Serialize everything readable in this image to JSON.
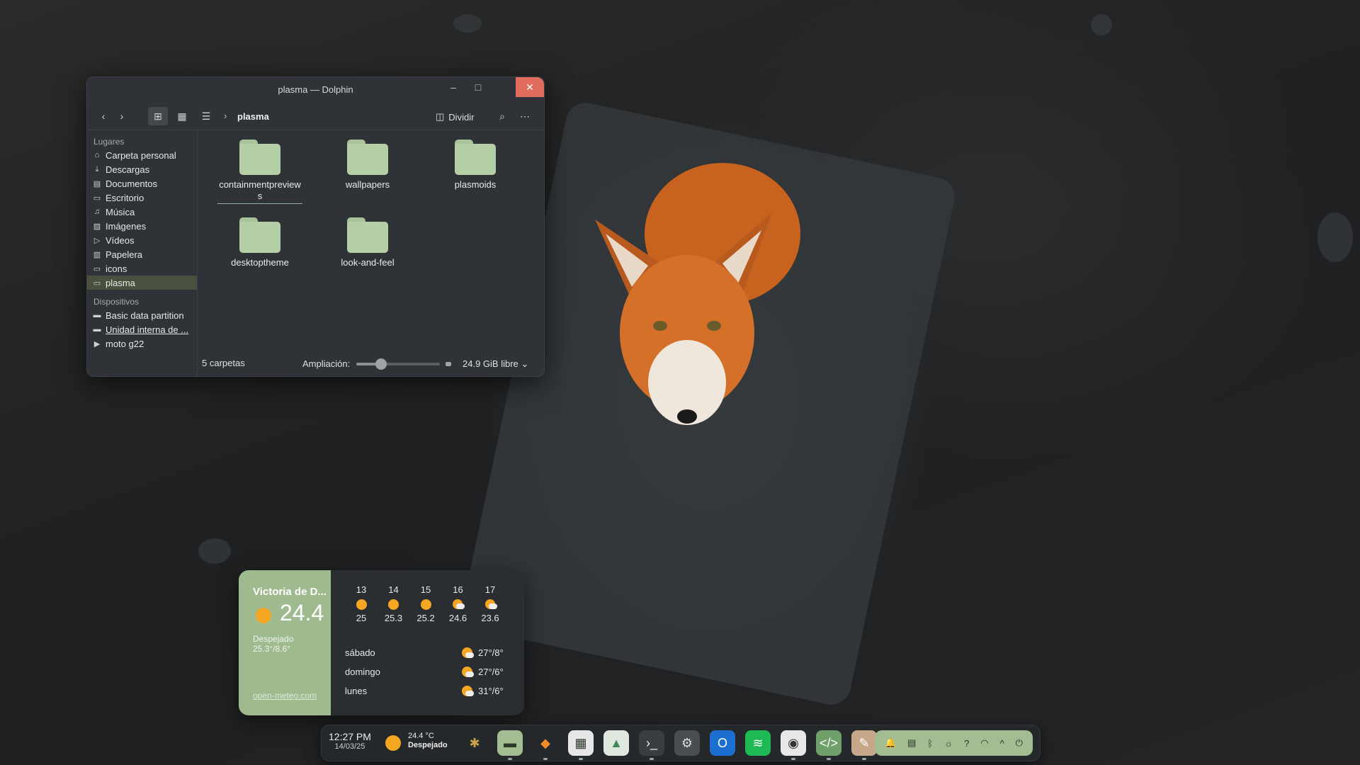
{
  "window": {
    "title": "plasma — Dolphin",
    "breadcrumb_current": "plasma",
    "split_label": "Dividir",
    "controls": {
      "minimize": "–",
      "maximize": "□",
      "close": "✕"
    }
  },
  "sidebar": {
    "places_header": "Lugares",
    "places": [
      {
        "label": "Carpeta personal",
        "icon": "home-icon",
        "glyph": "⌂"
      },
      {
        "label": "Descargas",
        "icon": "download-icon",
        "glyph": "⤓"
      },
      {
        "label": "Documentos",
        "icon": "document-icon",
        "glyph": "▤"
      },
      {
        "label": "Escritorio",
        "icon": "desktop-icon",
        "glyph": "▭"
      },
      {
        "label": "Música",
        "icon": "music-icon",
        "glyph": "♫"
      },
      {
        "label": "Imágenes",
        "icon": "image-icon",
        "glyph": "▨"
      },
      {
        "label": "Vídeos",
        "icon": "video-icon",
        "glyph": "▷"
      },
      {
        "label": "Papelera",
        "icon": "trash-icon",
        "glyph": "▥"
      },
      {
        "label": "icons",
        "icon": "folder-icon",
        "glyph": "▭"
      },
      {
        "label": "plasma",
        "icon": "folder-icon",
        "glyph": "▭"
      }
    ],
    "devices_header": "Dispositivos",
    "devices": [
      {
        "label": "Basic data partition",
        "icon": "drive-icon",
        "glyph": "▬"
      },
      {
        "label": "Unidad interna de ...",
        "icon": "drive-icon",
        "glyph": "▬"
      },
      {
        "label": "moto g22",
        "icon": "phone-icon",
        "glyph": "▶"
      }
    ]
  },
  "folders": [
    {
      "label": "containmentpreviews",
      "selected": true
    },
    {
      "label": "wallpapers"
    },
    {
      "label": "plasmoids"
    },
    {
      "label": "desktoptheme"
    },
    {
      "label": "look-and-feel"
    }
  ],
  "status": {
    "count": "5 carpetas",
    "zoom_label": "Ampliación:",
    "zoom_fraction": 0.3,
    "free_space": "24.9 GiB libre"
  },
  "weather": {
    "city": "Victoria de D...",
    "temp": "24.4",
    "condition": "Despejado",
    "range": "25.3°/8.6°",
    "source": "open-meteo.com",
    "hourly": [
      {
        "hour": "13",
        "temp": "25",
        "icon": "sun"
      },
      {
        "hour": "14",
        "temp": "25.3",
        "icon": "sun"
      },
      {
        "hour": "15",
        "temp": "25.2",
        "icon": "sun"
      },
      {
        "hour": "16",
        "temp": "24.6",
        "icon": "partly-cloudy"
      },
      {
        "hour": "17",
        "temp": "23.6",
        "icon": "partly-cloudy"
      }
    ],
    "daily": [
      {
        "day": "sábado",
        "temps": "27°/8°"
      },
      {
        "day": "domingo",
        "temps": "27°/6°"
      },
      {
        "day": "lunes",
        "temps": "31°/6°"
      }
    ]
  },
  "taskbar": {
    "time": "12:27 PM",
    "date": "14/03/25",
    "weather_temp": "24.4 °C",
    "weather_cond": "Despejado",
    "apps": [
      {
        "name": "kde-menu-icon",
        "glyph": "✱",
        "color": "#c9a24a",
        "bg": "transparent"
      },
      {
        "name": "dolphin-icon",
        "glyph": "▬",
        "color": "#2b3a2b",
        "bg": "#a3bd93",
        "running": true
      },
      {
        "name": "firefox-icon",
        "glyph": "◆",
        "color": "#f08a2a",
        "bg": "transparent",
        "running": true
      },
      {
        "name": "store-icon",
        "glyph": "▦",
        "color": "#2b3a2b",
        "bg": "#e6e6e6",
        "running": true
      },
      {
        "name": "image-viewer-icon",
        "glyph": "▲",
        "color": "#3c8a5a",
        "bg": "#dfe8df"
      },
      {
        "name": "terminal-icon",
        "glyph": "›_",
        "color": "#eee",
        "bg": "#3a3d40",
        "running": true
      },
      {
        "name": "settings-icon",
        "glyph": "⚙",
        "color": "#ddd",
        "bg": "#4a4d50"
      },
      {
        "name": "outlook-icon",
        "glyph": "O",
        "color": "#fff",
        "bg": "#1a6fd0"
      },
      {
        "name": "spotify-icon",
        "glyph": "≋",
        "color": "#fff",
        "bg": "#1db954"
      },
      {
        "name": "android-icon",
        "glyph": "◉",
        "color": "#333",
        "bg": "#e8e8e8",
        "running": true
      },
      {
        "name": "code-editor-icon",
        "glyph": "</>",
        "color": "#fff",
        "bg": "#6fa06a",
        "running": true
      },
      {
        "name": "feather-app-icon",
        "glyph": "✎",
        "color": "#fff",
        "bg": "#c7a78a",
        "running": true
      }
    ],
    "tray": [
      {
        "name": "notifications-icon",
        "glyph": "🔔"
      },
      {
        "name": "clipboard-icon",
        "glyph": "▤"
      },
      {
        "name": "bluetooth-icon",
        "glyph": "ᛒ"
      },
      {
        "name": "brightness-icon",
        "glyph": "☼"
      },
      {
        "name": "help-icon",
        "glyph": "?"
      },
      {
        "name": "wifi-icon",
        "glyph": "◠"
      },
      {
        "name": "expand-tray-icon",
        "glyph": "^"
      },
      {
        "name": "power-icon",
        "glyph": "⏻"
      }
    ]
  }
}
